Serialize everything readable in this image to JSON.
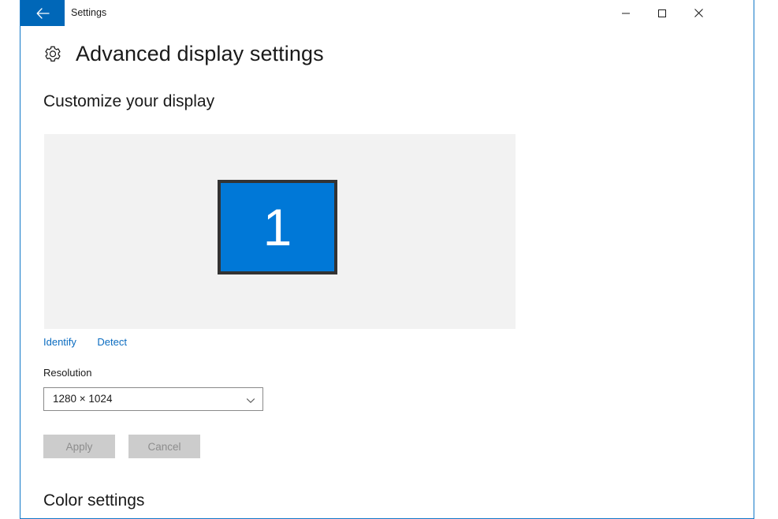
{
  "window": {
    "title": "Settings",
    "back_icon": "arrow-left-icon",
    "controls": {
      "minimize": "minimize-icon",
      "maximize": "maximize-icon",
      "close": "close-icon"
    },
    "border_color": "#1278c8",
    "back_button_color": "#0067b8"
  },
  "page": {
    "icon": "gear-icon",
    "title": "Advanced display settings",
    "section_title": "Customize your display"
  },
  "display_preview": {
    "background_color": "#f2f2f2",
    "monitor": {
      "number": "1",
      "fill_color": "#0078d7",
      "border_color": "#333333"
    },
    "links": [
      {
        "label": "Identify",
        "name": "identify-link"
      },
      {
        "label": "Detect",
        "name": "detect-link"
      }
    ],
    "link_color": "#0b6cc0"
  },
  "resolution": {
    "label": "Resolution",
    "value": "1280 × 1024",
    "chevron_icon": "chevron-down-icon",
    "options": [
      "1280 × 1024"
    ]
  },
  "actions": {
    "apply_label": "Apply",
    "cancel_label": "Cancel",
    "disabled_bg": "#cccccc",
    "disabled_text": "#8d8d8d"
  },
  "color_settings": {
    "title": "Color settings"
  }
}
